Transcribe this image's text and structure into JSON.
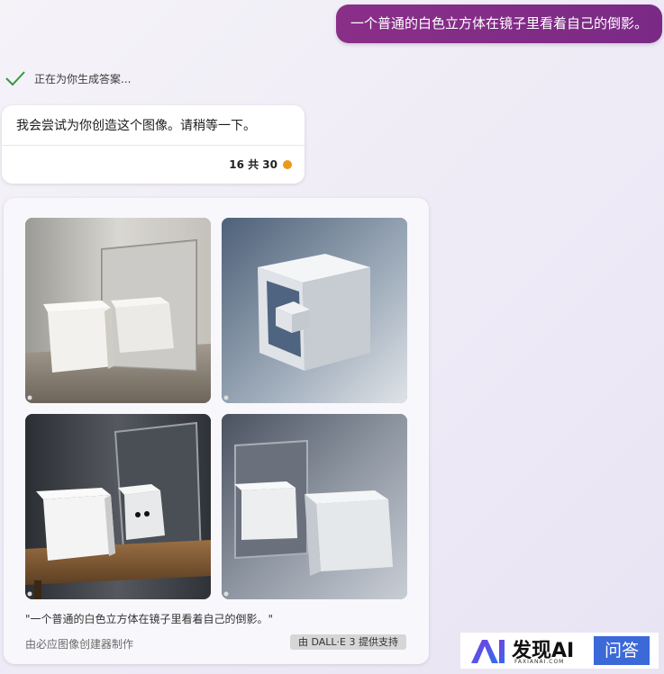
{
  "user_message": "一个普通的白色立方体在镜子里看着自己的倒影。",
  "status": {
    "text": "正在为你生成答案...",
    "icon": "checkmark-icon"
  },
  "bot_message": {
    "text": "我会尝试为你创造这个图像。请稍等一下。",
    "count_text": "16 共 30",
    "dot_color": "#e99a1a"
  },
  "image_card": {
    "images": [
      {
        "name": "cube-mirror-image-1",
        "icon": "bing-icon"
      },
      {
        "name": "cube-mirror-image-2",
        "icon": "bing-icon"
      },
      {
        "name": "cube-mirror-image-3",
        "icon": "bing-icon"
      },
      {
        "name": "cube-mirror-image-4",
        "icon": "bing-icon"
      }
    ],
    "caption": "\"一个普通的白色立方体在镜子里看着自己的倒影。\"",
    "made_by": "由必应图像创建器制作",
    "powered_by": "由 DALL·E 3 提供支持"
  },
  "watermark": {
    "logo_text": "AI",
    "title": "发现AI",
    "subtitle": "FAXIANAI.COM",
    "badge": "问答"
  },
  "colors": {
    "user_bubble": "#7e2c87",
    "check": "#2e9d3c",
    "watermark_badge": "#3b69d8"
  }
}
